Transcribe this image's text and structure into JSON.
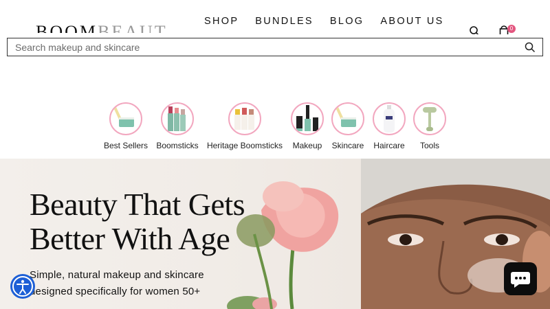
{
  "brand": {
    "name_part1": "BOOM",
    "name_part2": "BEAUTY"
  },
  "nav": {
    "items": [
      "SHOP",
      "BUNDLES",
      "BLOG",
      "ABOUT US"
    ]
  },
  "cart": {
    "count": "0"
  },
  "search": {
    "placeholder": "Search makeup and skincare"
  },
  "categories": [
    {
      "label": "Best Sellers",
      "icon": "best-sellers-product-icon"
    },
    {
      "label": "Boomsticks",
      "icon": "boomsticks-product-icon"
    },
    {
      "label": "Heritage Boomsticks",
      "icon": "heritage-boomsticks-product-icon"
    },
    {
      "label": "Makeup",
      "icon": "makeup-product-icon"
    },
    {
      "label": "Skincare",
      "icon": "skincare-product-icon"
    },
    {
      "label": "Haircare",
      "icon": "haircare-product-icon"
    },
    {
      "label": "Tools",
      "icon": "tools-product-icon"
    }
  ],
  "hero": {
    "title_line1": "Beauty That Gets",
    "title_line2": "Better With Age",
    "subtitle_line1": "Simple, natural makeup and skincare",
    "subtitle_line2": "designed specifically for women 50+"
  },
  "colors": {
    "accent_pink": "#f2a7bf",
    "badge": "#e3567f",
    "access_blue": "#1d5fd6"
  }
}
